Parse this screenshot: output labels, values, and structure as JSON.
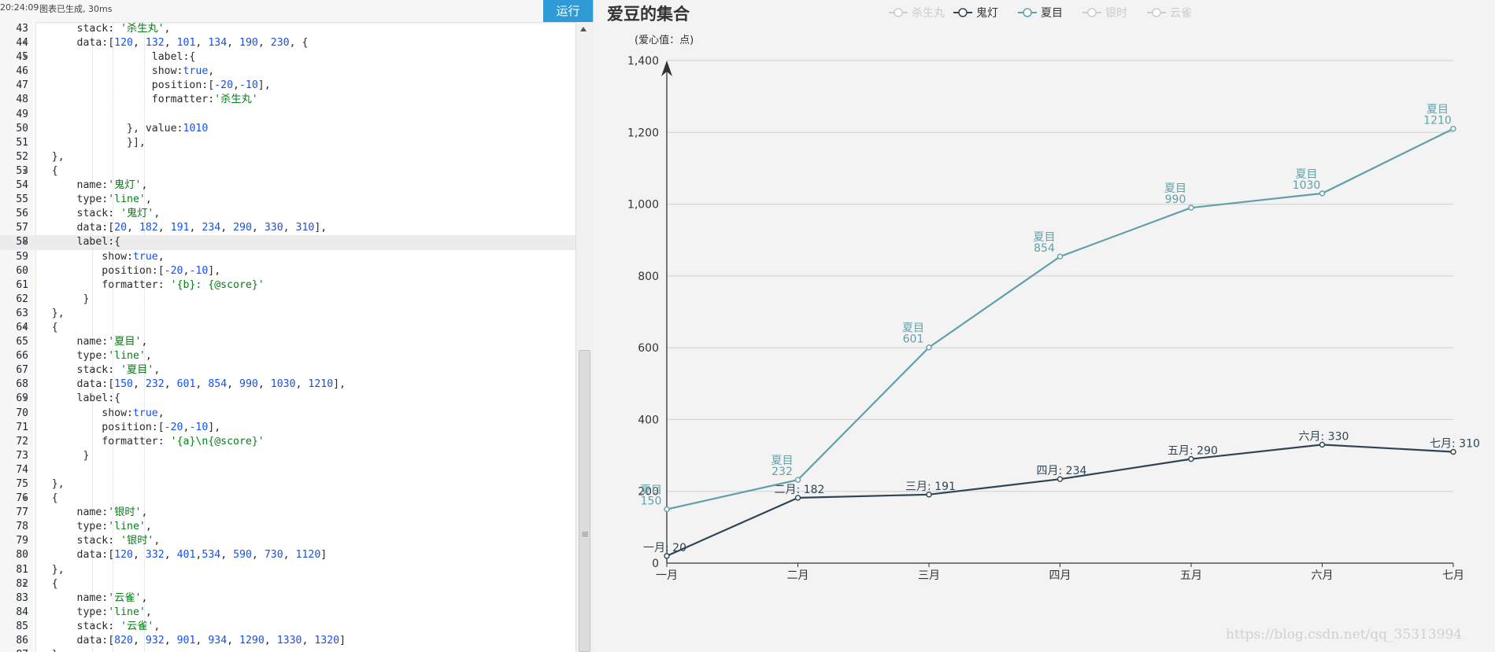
{
  "status": {
    "time": "20:24:09",
    "message": "图表已生成, 30ms",
    "run_label": "运行"
  },
  "editor": {
    "lines": [
      {
        "n": "43",
        "fold": false,
        "text": "        stack: '杀生丸',"
      },
      {
        "n": "44",
        "fold": true,
        "text": "        data:[120, 132, 101, 134, 190, 230, {"
      },
      {
        "n": "45",
        "fold": true,
        "text": "                    label:{"
      },
      {
        "n": "46",
        "fold": false,
        "text": "                    show:true,"
      },
      {
        "n": "47",
        "fold": false,
        "text": "                    position:[-20,-10],"
      },
      {
        "n": "48",
        "fold": false,
        "text": "                    formatter:'杀生丸'"
      },
      {
        "n": "49",
        "fold": false,
        "text": ""
      },
      {
        "n": "50",
        "fold": false,
        "text": "                }, value:1010"
      },
      {
        "n": "51",
        "fold": false,
        "text": "                }],"
      },
      {
        "n": "52",
        "fold": false,
        "text": "    },"
      },
      {
        "n": "53",
        "fold": true,
        "text": "    {"
      },
      {
        "n": "54",
        "fold": false,
        "text": "        name:'鬼灯',"
      },
      {
        "n": "55",
        "fold": false,
        "text": "        type:'line',"
      },
      {
        "n": "56",
        "fold": false,
        "text": "        stack: '鬼灯',"
      },
      {
        "n": "57",
        "fold": false,
        "text": "        data:[20, 182, 191, 234, 290, 330, 310],"
      },
      {
        "n": "58",
        "fold": true,
        "text": "        label:{",
        "active": true
      },
      {
        "n": "59",
        "fold": false,
        "text": "            show:true,"
      },
      {
        "n": "60",
        "fold": false,
        "text": "            position:[-20,-10],"
      },
      {
        "n": "61",
        "fold": false,
        "text": "            formatter: '{b}: {@score}'"
      },
      {
        "n": "62",
        "fold": false,
        "text": "         }"
      },
      {
        "n": "63",
        "fold": false,
        "text": "    },"
      },
      {
        "n": "64",
        "fold": true,
        "text": "    {"
      },
      {
        "n": "65",
        "fold": false,
        "text": "        name:'夏目',"
      },
      {
        "n": "66",
        "fold": false,
        "text": "        type:'line',"
      },
      {
        "n": "67",
        "fold": false,
        "text": "        stack: '夏目',"
      },
      {
        "n": "68",
        "fold": false,
        "text": "        data:[150, 232, 601, 854, 990, 1030, 1210],"
      },
      {
        "n": "69",
        "fold": true,
        "text": "        label:{"
      },
      {
        "n": "70",
        "fold": false,
        "text": "            show:true,"
      },
      {
        "n": "71",
        "fold": false,
        "text": "            position:[-20,-10],"
      },
      {
        "n": "72",
        "fold": false,
        "text": "            formatter: '{a}\\n{@score}'"
      },
      {
        "n": "73",
        "fold": false,
        "text": "         }"
      },
      {
        "n": "74",
        "fold": false,
        "text": ""
      },
      {
        "n": "75",
        "fold": false,
        "text": "    },"
      },
      {
        "n": "76",
        "fold": true,
        "text": "    {"
      },
      {
        "n": "77",
        "fold": false,
        "text": "        name:'银时',"
      },
      {
        "n": "78",
        "fold": false,
        "text": "        type:'line',"
      },
      {
        "n": "79",
        "fold": false,
        "text": "        stack: '银时',"
      },
      {
        "n": "80",
        "fold": false,
        "text": "        data:[120, 332, 401,534, 590, 730, 1120]"
      },
      {
        "n": "81",
        "fold": false,
        "text": "    },"
      },
      {
        "n": "82",
        "fold": true,
        "text": "    {"
      },
      {
        "n": "83",
        "fold": false,
        "text": "        name:'云雀',"
      },
      {
        "n": "84",
        "fold": false,
        "text": "        type:'line',"
      },
      {
        "n": "85",
        "fold": false,
        "text": "        stack: '云雀',"
      },
      {
        "n": "86",
        "fold": false,
        "text": "        data:[820, 932, 901, 934, 1290, 1330, 1320]"
      },
      {
        "n": "87",
        "fold": false,
        "text": "    }"
      }
    ]
  },
  "chart_data": {
    "type": "line",
    "title": "爱豆的集合",
    "ylabel": "(爱心值：点)",
    "xlabel": "",
    "categories": [
      "一月",
      "二月",
      "三月",
      "四月",
      "五月",
      "六月",
      "七月"
    ],
    "ylim": [
      0,
      1400
    ],
    "yticks": [
      0,
      200,
      400,
      600,
      800,
      1000,
      1200,
      1400
    ],
    "ytick_labels": [
      "0",
      "200",
      "400",
      "600",
      "800",
      "1,000",
      "1,200",
      "1,400"
    ],
    "grid": true,
    "legend_position": "top",
    "legend": [
      {
        "name": "杀生丸",
        "active": false
      },
      {
        "name": "鬼灯",
        "active": true
      },
      {
        "name": "夏目",
        "active": true
      },
      {
        "name": "银时",
        "active": false
      },
      {
        "name": "云雀",
        "active": false
      }
    ],
    "series": [
      {
        "name": "鬼灯",
        "color": "#2f4554",
        "values": [
          20,
          182,
          191,
          234,
          290,
          330,
          310
        ],
        "labels": [
          "一月: 20",
          "二月: 182",
          "三月: 191",
          "四月: 234",
          "五月: 290",
          "六月: 330",
          "七月: 310"
        ]
      },
      {
        "name": "夏目",
        "color": "#61a0a8",
        "values": [
          150,
          232,
          601,
          854,
          990,
          1030,
          1210
        ],
        "labels": [
          [
            "夏目",
            "150"
          ],
          [
            "夏目",
            "232"
          ],
          [
            "夏目",
            "601"
          ],
          [
            "夏目",
            "854"
          ],
          [
            "夏目",
            "990"
          ],
          [
            "夏目",
            "1030"
          ],
          [
            "夏目",
            "1210"
          ]
        ]
      }
    ],
    "colors": {
      "inactive": "#cccccc",
      "axis": "#333333",
      "grid": "#cfcfcf",
      "title": "#333333"
    }
  },
  "watermark": "https://blog.csdn.net/qq_35313994"
}
